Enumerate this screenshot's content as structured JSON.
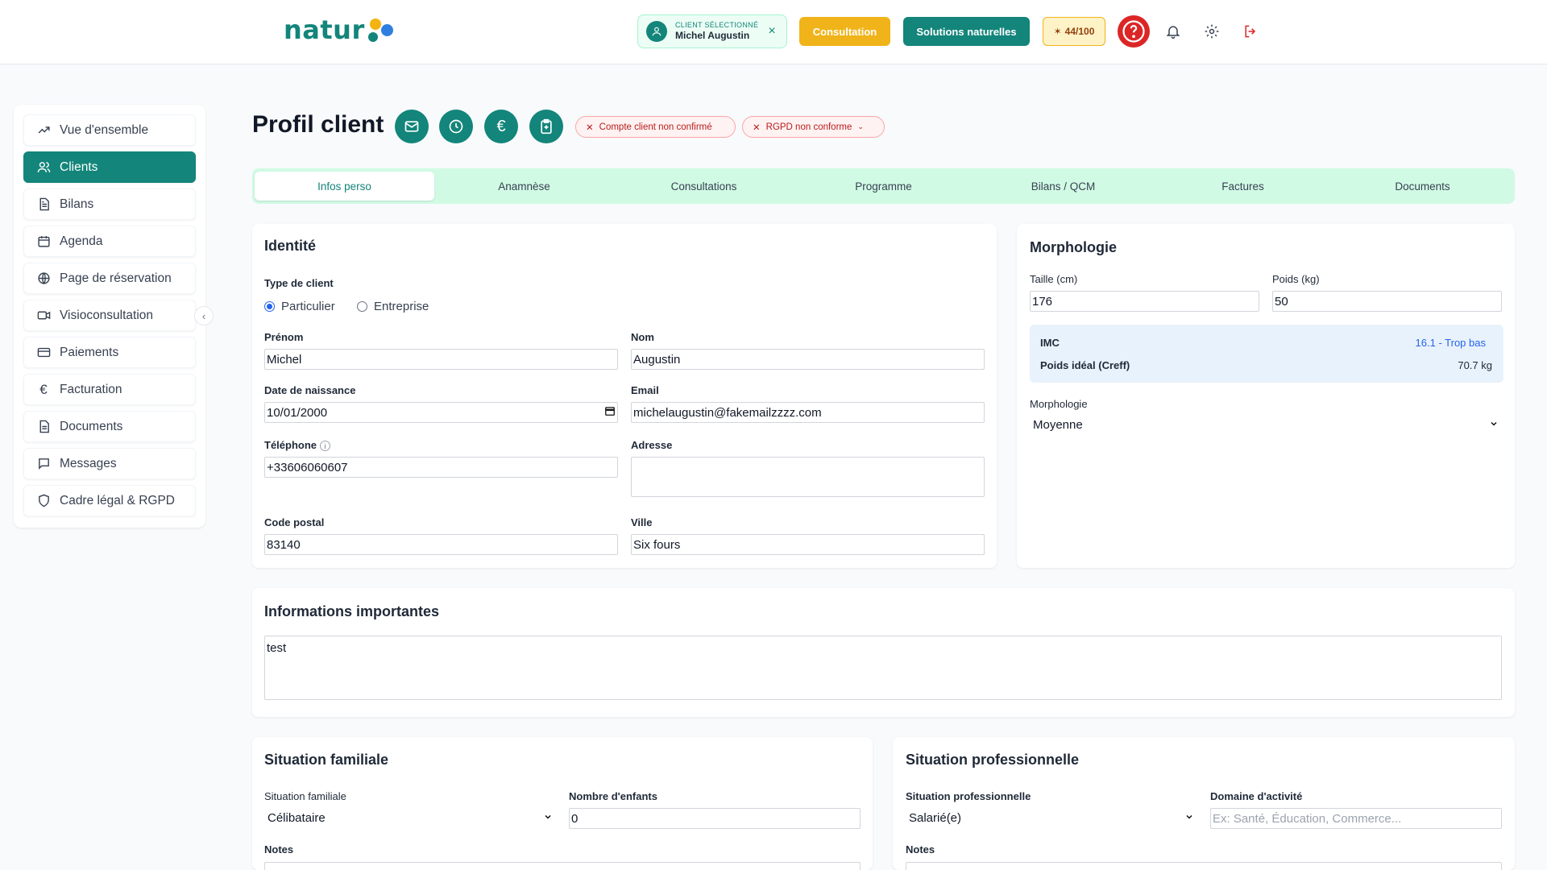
{
  "header": {
    "logo_text": "natur",
    "client_chip": {
      "caption": "CLIENT SÉLECTIONNÉ",
      "name": "Michel Augustin",
      "close": "×"
    },
    "consultation_label": "Consultation",
    "solutions_label": "Solutions naturelles",
    "credits": "44/100"
  },
  "sidebar": {
    "items": [
      {
        "label": "Vue d'ensemble",
        "icon": "trending-up-icon"
      },
      {
        "label": "Clients",
        "icon": "users-icon",
        "active": true
      },
      {
        "label": "Bilans",
        "icon": "file-text-icon"
      },
      {
        "label": "Agenda",
        "icon": "calendar-icon"
      },
      {
        "label": "Page de réservation",
        "icon": "globe-icon"
      },
      {
        "label": "Visioconsultation",
        "icon": "video-icon"
      },
      {
        "label": "Paiements",
        "icon": "credit-card-icon"
      },
      {
        "label": "Facturation",
        "icon": "euro-icon"
      },
      {
        "label": "Documents",
        "icon": "document-icon"
      },
      {
        "label": "Messages",
        "icon": "message-icon"
      },
      {
        "label": "Cadre légal & RGPD",
        "icon": "shield-icon"
      }
    ],
    "collapse": "‹"
  },
  "page": {
    "title": "Profil client",
    "badges": {
      "account": "Compte client non confirmé",
      "rgpd": "RGPD non conforme"
    }
  },
  "tabs": [
    "Infos perso",
    "Anamnèse",
    "Consultations",
    "Programme",
    "Bilans / QCM",
    "Factures",
    "Documents"
  ],
  "identity": {
    "title": "Identité",
    "type_label": "Type de client",
    "type_options": [
      "Particulier",
      "Entreprise"
    ],
    "prenom_label": "Prénom",
    "prenom": "Michel",
    "nom_label": "Nom",
    "nom": "Augustin",
    "dob_label": "Date de naissance",
    "dob": "10/01/2000",
    "email_label": "Email",
    "email": "michelaugustin@fakemailzzzz.com",
    "phone_label": "Téléphone",
    "phone": "+33606060607",
    "address_label": "Adresse",
    "address": "",
    "postal_label": "Code postal",
    "postal": "83140",
    "city_label": "Ville",
    "city": "Six fours"
  },
  "morphology": {
    "title": "Morphologie",
    "height_label": "Taille (cm)",
    "height": "176",
    "weight_label": "Poids (kg)",
    "weight": "50",
    "imc_label": "IMC",
    "imc_value": "16.1 - Trop bas",
    "ideal_label": "Poids idéal (Creff)",
    "ideal_value": "70.7 kg",
    "morph_label": "Morphologie",
    "morph_value": "Moyenne"
  },
  "important": {
    "title": "Informations importantes",
    "text": "test"
  },
  "family": {
    "title": "Situation familiale",
    "status_label": "Situation familiale",
    "status": "Célibataire",
    "children_label": "Nombre d'enfants",
    "children": "0",
    "notes_label": "Notes"
  },
  "professional": {
    "title": "Situation professionnelle",
    "status_label": "Situation professionnelle",
    "status": "Salarié(e)",
    "domain_label": "Domaine d'activité",
    "domain_placeholder": "Ex: Santé, Éducation, Commerce...",
    "notes_label": "Notes"
  },
  "colors": {
    "primary": "#13857a",
    "accent": "#f0b41a",
    "danger": "#dc2626",
    "tab_bg": "#d1fae5"
  }
}
